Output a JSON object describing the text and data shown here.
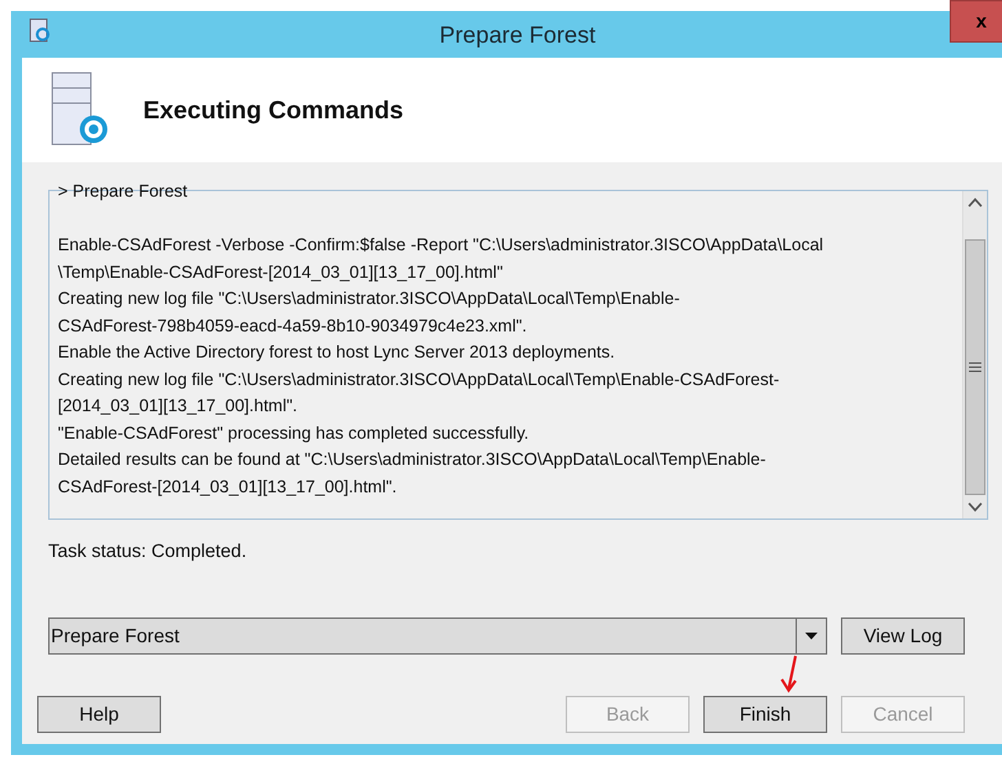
{
  "window": {
    "title": "Prepare Forest",
    "close": "x"
  },
  "header": {
    "title": "Executing Commands"
  },
  "log_lines": [
    "> Prepare Forest",
    "Enable-CSAdForest  -Verbose -Confirm:$false -Report \"C:\\Users\\administrator.3ISCO\\AppData\\Local",
    "\\Temp\\Enable-CSAdForest-[2014_03_01][13_17_00].html\"",
    "Creating new log file \"C:\\Users\\administrator.3ISCO\\AppData\\Local\\Temp\\Enable-",
    "CSAdForest-798b4059-eacd-4a59-8b10-9034979c4e23.xml\".",
    "Enable the Active Directory forest to host Lync Server 2013 deployments.",
    "Creating new log file \"C:\\Users\\administrator.3ISCO\\AppData\\Local\\Temp\\Enable-CSAdForest-",
    "[2014_03_01][13_17_00].html\".",
    "\"Enable-CSAdForest\" processing has completed successfully.",
    "Detailed results can be found at \"C:\\Users\\administrator.3ISCO\\AppData\\Local\\Temp\\Enable-",
    "CSAdForest-[2014_03_01][13_17_00].html\"."
  ],
  "task_status": "Task status: Completed.",
  "task_select": {
    "value": "Prepare Forest"
  },
  "view_log": {
    "label": "View Log",
    "disabled": false
  },
  "buttons": [
    {
      "label": "Help",
      "disabled": false
    },
    {
      "label": "Back",
      "disabled": true
    },
    {
      "label": "Finish",
      "disabled": false
    },
    {
      "label": "Cancel",
      "disabled": true
    }
  ]
}
